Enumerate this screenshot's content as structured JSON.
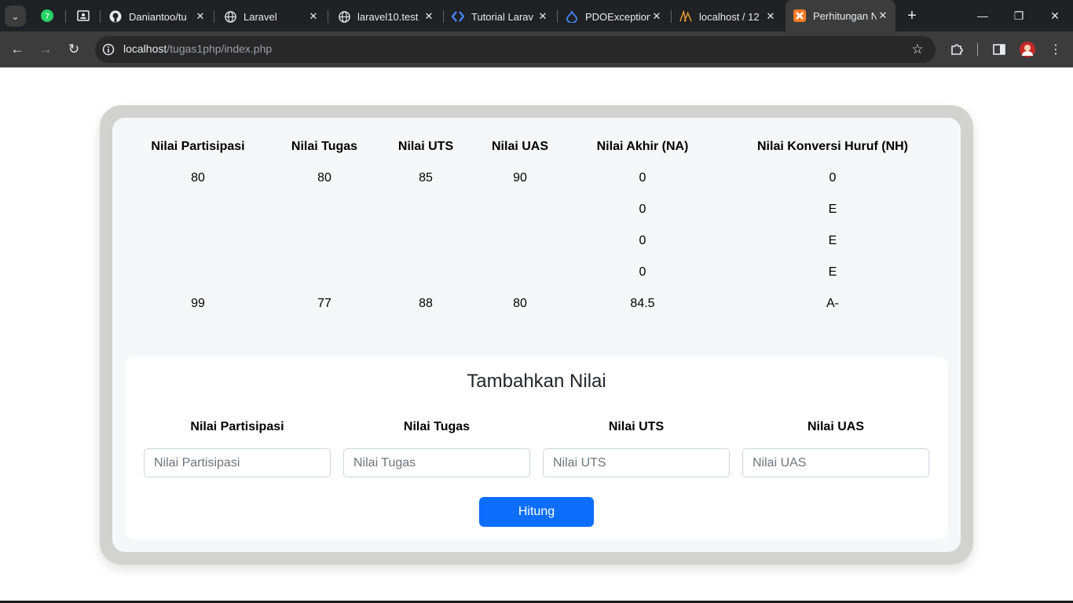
{
  "browser": {
    "tabs": [
      {
        "title": "Daniantoo/tu",
        "icon": "github-icon"
      },
      {
        "title": "Laravel",
        "icon": "globe-icon"
      },
      {
        "title": "laravel10.test",
        "icon": "globe-icon"
      },
      {
        "title": "Tutorial Larav",
        "icon": "code-icon"
      },
      {
        "title": "PDOException",
        "icon": "drupal-icon"
      },
      {
        "title": "localhost / 12",
        "icon": "phpmyadmin-icon"
      },
      {
        "title": "Perhitungan N",
        "icon": "xampp-icon",
        "active": true
      }
    ],
    "url_host": "localhost",
    "url_path": "/tugas1php/index.php",
    "accent_active_tab": "#3c3c3c"
  },
  "grades_table": {
    "headers": [
      "Nilai Partisipasi",
      "Nilai Tugas",
      "Nilai UTS",
      "Nilai UAS",
      "Nilai Akhir (NA)",
      "Nilai Konversi Huruf (NH)"
    ],
    "rows": [
      [
        "80",
        "80",
        "85",
        "90",
        "0",
        "0"
      ],
      [
        "",
        "",
        "",
        "",
        "0",
        "E"
      ],
      [
        "",
        "",
        "",
        "",
        "0",
        "E"
      ],
      [
        "",
        "",
        "",
        "",
        "0",
        "E"
      ],
      [
        "99",
        "77",
        "88",
        "80",
        "84.5",
        "A-"
      ]
    ]
  },
  "form": {
    "title": "Tambahkan Nilai",
    "fields": [
      {
        "label": "Nilai Partisipasi",
        "placeholder": "Nilai Partisipasi",
        "value": ""
      },
      {
        "label": "Nilai Tugas",
        "placeholder": "Nilai Tugas",
        "value": ""
      },
      {
        "label": "Nilai UTS",
        "placeholder": "Nilai UTS",
        "value": ""
      },
      {
        "label": "Nilai UAS",
        "placeholder": "Nilai UAS",
        "value": ""
      }
    ],
    "submit_label": "Hitung",
    "button_color": "#0d6efd"
  }
}
